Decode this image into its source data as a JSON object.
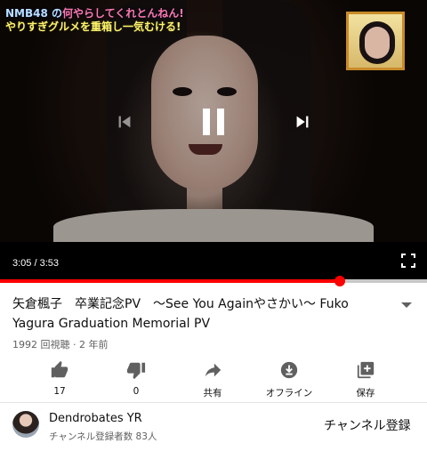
{
  "player": {
    "tv_caption_line1_prefix": "NMB48 の",
    "tv_caption_line1_highlight": "何やらしてくれとんねん!",
    "tv_caption_line2": "やりすぎグルメを",
    "tv_caption_line2_tail": "重箱し一気むける!",
    "current_time": "3:05",
    "duration": "3:53",
    "time_separator": " / ",
    "progress": 0.795
  },
  "video": {
    "title": "矢倉楓子　卒業記念PV　〜See You Againやさかい〜 Fuko Yagura Graduation Memorial PV",
    "views": "1992 回視聴",
    "age": "2 年前",
    "meta_separator": " · "
  },
  "actions": [
    {
      "name": "like",
      "label": "17",
      "icon": "thumbs-up-icon"
    },
    {
      "name": "dislike",
      "label": "0",
      "icon": "thumbs-down-icon"
    },
    {
      "name": "share",
      "label": "共有",
      "icon": "share-icon"
    },
    {
      "name": "download",
      "label": "オフライン",
      "icon": "download-icon"
    },
    {
      "name": "save",
      "label": "保存",
      "icon": "playlist-add-icon"
    }
  ],
  "channel": {
    "name": "Dendrobates YR",
    "subscribers": "チャンネル登録者数 83人",
    "subscribe_label": "チャンネル登録"
  },
  "colors": {
    "progress": "#ff0000",
    "track": "#c8c8c8",
    "icon": "#606060"
  }
}
